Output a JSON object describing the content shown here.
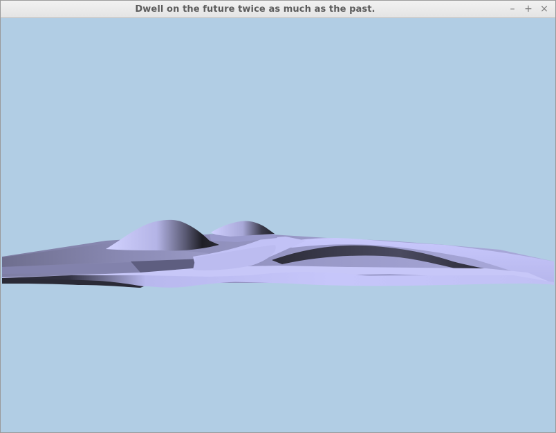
{
  "window": {
    "title": "Dwell on the future twice as much as the past.",
    "controls": {
      "minimize_icon": "minimize-icon",
      "maximize_icon": "maximize-icon",
      "close_icon": "close-icon",
      "minimize_glyph": "–",
      "maximize_glyph": "+",
      "close_glyph": "×"
    }
  },
  "viewport": {
    "content": "3D rendered terrain surface",
    "colors": {
      "sky": "#b1cde4",
      "terrain_light": "#c9c9fb",
      "terrain_mid": "#8c8cb8",
      "terrain_dark": "#1e1e24"
    }
  }
}
